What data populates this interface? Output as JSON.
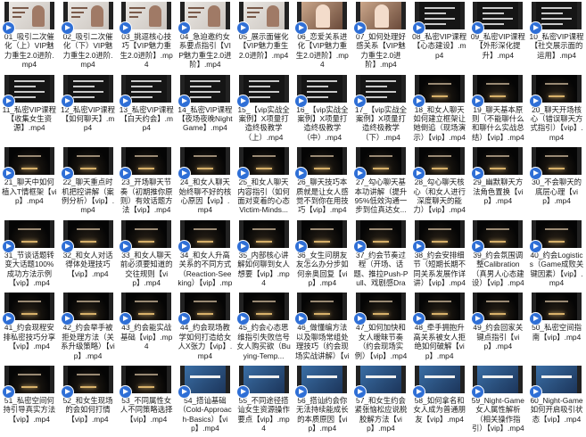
{
  "files": [
    {
      "name": "01_吸引二次催化（上）VIP魅力重生2.0进阶.mp4",
      "thumb": "light"
    },
    {
      "name": "02_吸引二次催化（下）VIP魅力重生2.0进阶.mp4",
      "thumb": "light"
    },
    {
      "name": "03_挑逗核心技巧【VIP魅力重生2.0进阶】.mp4",
      "thumb": "light"
    },
    {
      "name": "04_急迫邀约女系要点指引【VIP魅力重生2.0进阶】.mp4",
      "thumb": "light"
    },
    {
      "name": "05_展示面催化【VIP魅力重生2.0进阶】.mp4",
      "thumb": "light"
    },
    {
      "name": "06_恋爱关系进化【VIP魅力重生2.0进阶】.mp4",
      "thumb": "photo"
    },
    {
      "name": "07_如何处理好感关系【VIP魅力重生2.0进阶】.mp4",
      "thumb": "photo"
    },
    {
      "name": "08_私密VIP课程【心态建设】.mp4",
      "thumb": "slide"
    },
    {
      "name": "09_私密VIP课程【外形深化提升】.mp4",
      "thumb": "slide"
    },
    {
      "name": "10_私密VIP课程【社交展示面的运用】.mp4",
      "thumb": "slide"
    },
    {
      "name": "11_私密VIP课程【收集女生资源】.mp4",
      "thumb": "slide"
    },
    {
      "name": "12_私密VIP课程【如何聊天】.mp4",
      "thumb": "slide"
    },
    {
      "name": "13_私密VIP课程【白天约会】.mp4",
      "thumb": "slide"
    },
    {
      "name": "14_私密VIP课程【夜场夜晚NightGame】.mp4",
      "thumb": "slide"
    },
    {
      "name": "15_【vip实战全案例】X项量打造终极教学（上）.mp4",
      "thumb": "slide"
    },
    {
      "name": "16_【vip实战全案例】X项量打造终极教学（中）.mp4",
      "thumb": "slide"
    },
    {
      "name": "17_【vip实战全案例】X项量打造终极教学（下）.mp4",
      "thumb": "slide"
    },
    {
      "name": "18_和女人聊天如何建立框架让她倒追（现场演示）【vip】.mp4",
      "thumb": "dark"
    },
    {
      "name": "19_聊天基本原则（不能聊什么和聊什么实战总结）【vip】.mp4",
      "thumb": "dark"
    },
    {
      "name": "20_聊天开场核心（错误聊天方式指引）【vip】.mp4",
      "thumb": "dark"
    },
    {
      "name": "21_聊天中如何植入T情框架【vip】.mp4",
      "thumb": "dark"
    },
    {
      "name": "22_聊天重点时机把控讲解（案例分析）【vip】.mp4",
      "thumb": "dark"
    },
    {
      "name": "23_开场聊天节奏（初期推你原则）有效话题方法【vip】.mp4",
      "thumb": "dark"
    },
    {
      "name": "24_和女人聊天始终聊不好的核心原因【vip】.mp4",
      "thumb": "dark"
    },
    {
      "name": "25_和女人聊天内容指引（如何面对变着的心态Victim-Minds...",
      "thumb": "dark"
    },
    {
      "name": "26_聊天技巧本质就是让女人感觉不到你在用技巧【vip】.mp4",
      "thumb": "dark"
    },
    {
      "name": "27_勾心聊天基本功讲解（提升95%低效沟通一步到位真达女...",
      "thumb": "dark"
    },
    {
      "name": "28_勾心聊天核心（和女人进行深度聊天的能力）【vip】.mp4",
      "thumb": "dark"
    },
    {
      "name": "29_幽默聊天方法角色置换【vip】.mp4",
      "thumb": "dark"
    },
    {
      "name": "30_不会聊天的底层心理【vip】.mp4",
      "thumb": "dark"
    },
    {
      "name": "31_节谈话题转变大话题100%成功方法示例【vip】.mp4",
      "thumb": "dark"
    },
    {
      "name": "32_和女人对话得体处理技巧【vip】.mp4",
      "thumb": "dark"
    },
    {
      "name": "33_和女人聊天前必须要知道的交往规则【vip】.mp4",
      "thumb": "dark"
    },
    {
      "name": "34_和女人升高关系的不同方式（Reaction-Seeking）【vip】.mp4",
      "thumb": "dark"
    },
    {
      "name": "35_内部核心讲解如何聊到女人想要【vip】.mp4",
      "thumb": "dark"
    },
    {
      "name": "36_女生问朋友友怎么办分步如何亲奥回复【vip】.mp4",
      "thumb": "dark"
    },
    {
      "name": "37_约会节奏过程（开场、话题、推拉Push-Pull、戏剧感Drama...",
      "thumb": "dark"
    },
    {
      "name": "38_约会安排细节（短期长期不同关系发展作详讲）【vip】.mp4",
      "thumb": "dark"
    },
    {
      "name": "39_约会氛围调整Calibration（真男人心态建设）【vip】.mp4",
      "thumb": "dark"
    },
    {
      "name": "40_约会Logistics（Game成败关键因素）【vip】.mp4",
      "thumb": "dark"
    },
    {
      "name": "41_约会现程安排私密技巧分享【vip】.mp4",
      "thumb": "dark"
    },
    {
      "name": "42_约会举手被拒处理方法（关系升级策略）【vip】.mp4",
      "thumb": "dark"
    },
    {
      "name": "43_约会能实战基础【vip】.mp4",
      "thumb": "dark"
    },
    {
      "name": "44_约会现场教学如何打造给女人X张力【vip】.mp4",
      "thumb": "dark"
    },
    {
      "name": "45_约会心态思维指引失败信号女人购买欲（Buying-Temp...",
      "thumb": "dark"
    },
    {
      "name": "46_做懂编方法以及聊场常组处理技巧（约会现场实战讲解）【vip...",
      "thumb": "dark"
    },
    {
      "name": "47_如何加快和女人暧昧节奏（约会现场实例）【vip】.mp4",
      "thumb": "dark"
    },
    {
      "name": "48_牵手拥抱升高关系被女人拒绝如何破解【vip】.mp4",
      "thumb": "dark"
    },
    {
      "name": "49_约会回家关键点指引【vip】.mp4",
      "thumb": "dark"
    },
    {
      "name": "50_私密空间指南【vip】.mp4",
      "thumb": "dark"
    },
    {
      "name": "51_私密空间何持引导真实方法【vip】.mp4",
      "thumb": "dark"
    },
    {
      "name": "52_和女生现场的会如何打情【vip】.mp4",
      "thumb": "dark"
    },
    {
      "name": "53_不同属性女人不同策略选择【vip】.mp4",
      "thumb": "dark"
    },
    {
      "name": "54_搭讪基础（Cold-Approach-Basics）【vip】.mp4",
      "thumb": "blue"
    },
    {
      "name": "55_不同途径搭讪女生资源操作要点【vip】.mp4",
      "thumb": "blue"
    },
    {
      "name": "56_搭讪约会你无法持续能成长的本质原因【vip】.mp4",
      "thumb": "blue"
    },
    {
      "name": "57_和女生约会紧张恼松应说脱胶解方法【vip】.mp4",
      "thumb": "blue"
    },
    {
      "name": "58_如何拿名和女人成为普通朋友【vip】.mp4",
      "thumb": "blue"
    },
    {
      "name": "59_Night-Game女人属性解析（相关操作指引）【vip】.mp4",
      "thumb": "blue"
    },
    {
      "name": "60_Night-Game如何开启吸引状态【vip】.mp4",
      "thumb": "blue"
    }
  ],
  "icons": {
    "badge": "play-badge-icon"
  },
  "colors": {
    "badge": "#2f6fd6",
    "background": "#ffffff",
    "text": "#1a1a1a"
  }
}
